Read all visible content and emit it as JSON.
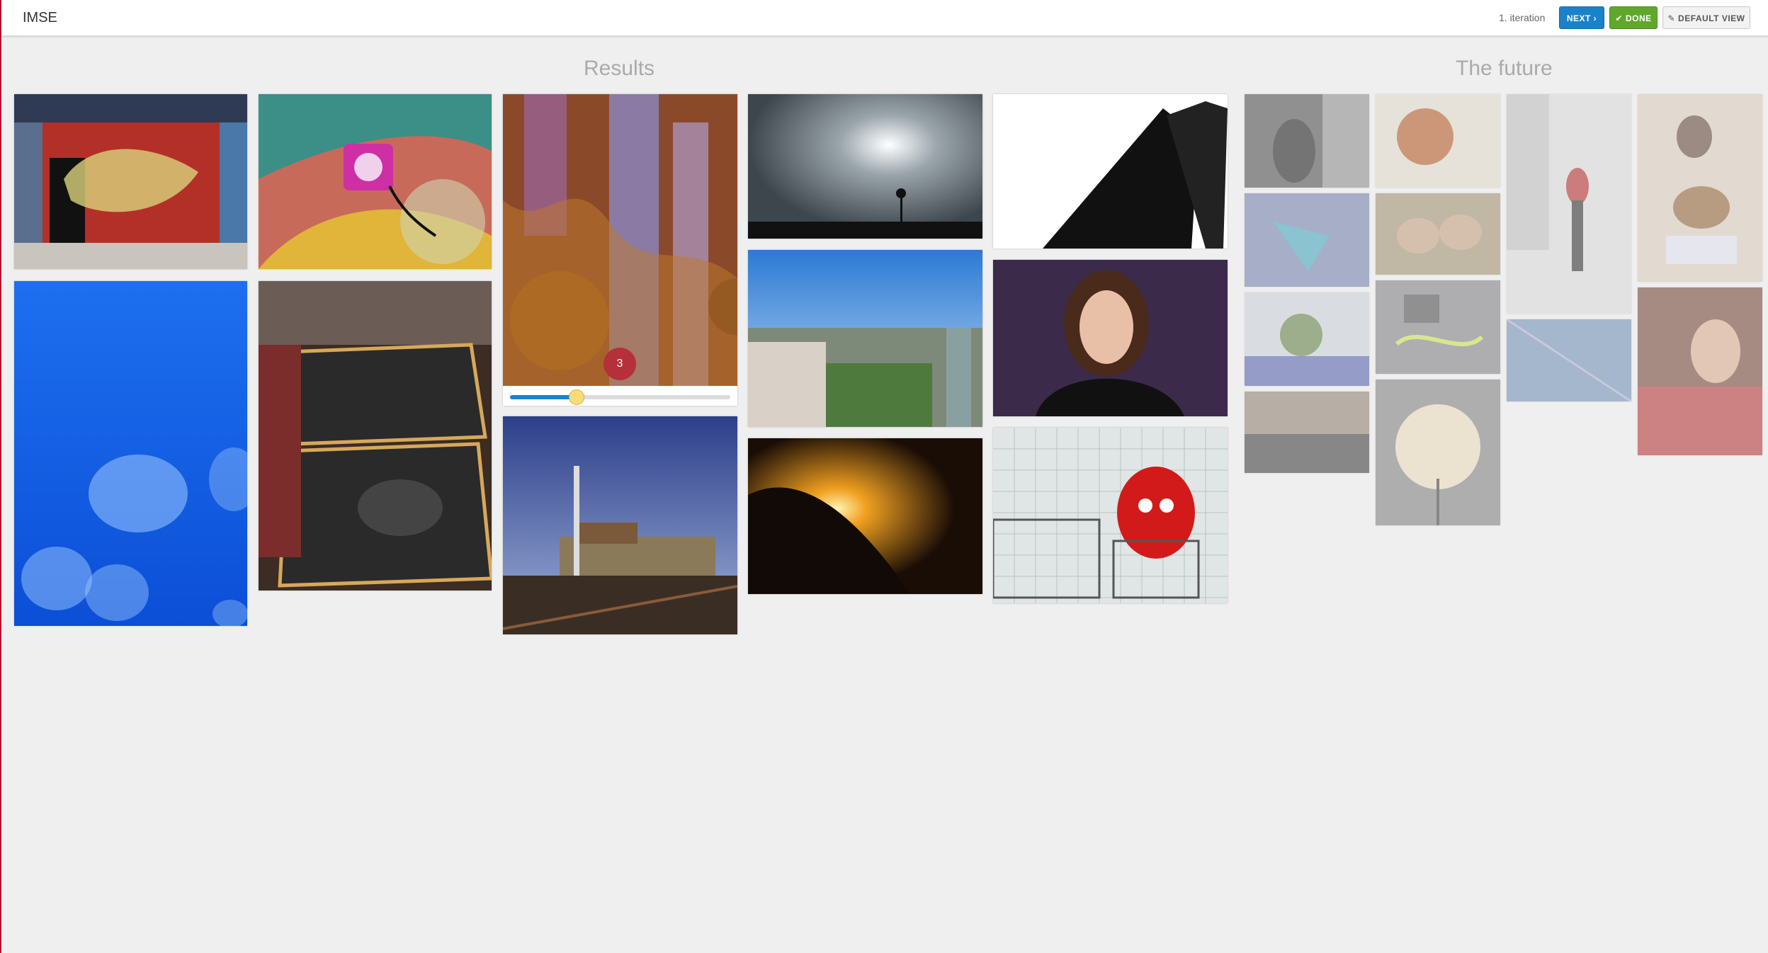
{
  "header": {
    "brand": "IMSE",
    "iteration": "1. iteration",
    "next_label": "NEXT",
    "done_label": "DONE",
    "default_view_label": "DEFAULT VIEW",
    "next_icon": "chevron-right-icon",
    "done_icon": "check-icon",
    "default_view_icon": "pencil-icon",
    "colors": {
      "next": "#1a82c9",
      "done": "#5fa82c"
    }
  },
  "results": {
    "title": "Results",
    "selected_rank": "3",
    "selected_slider_level": 0.3
  },
  "future": {
    "title": "The future"
  }
}
